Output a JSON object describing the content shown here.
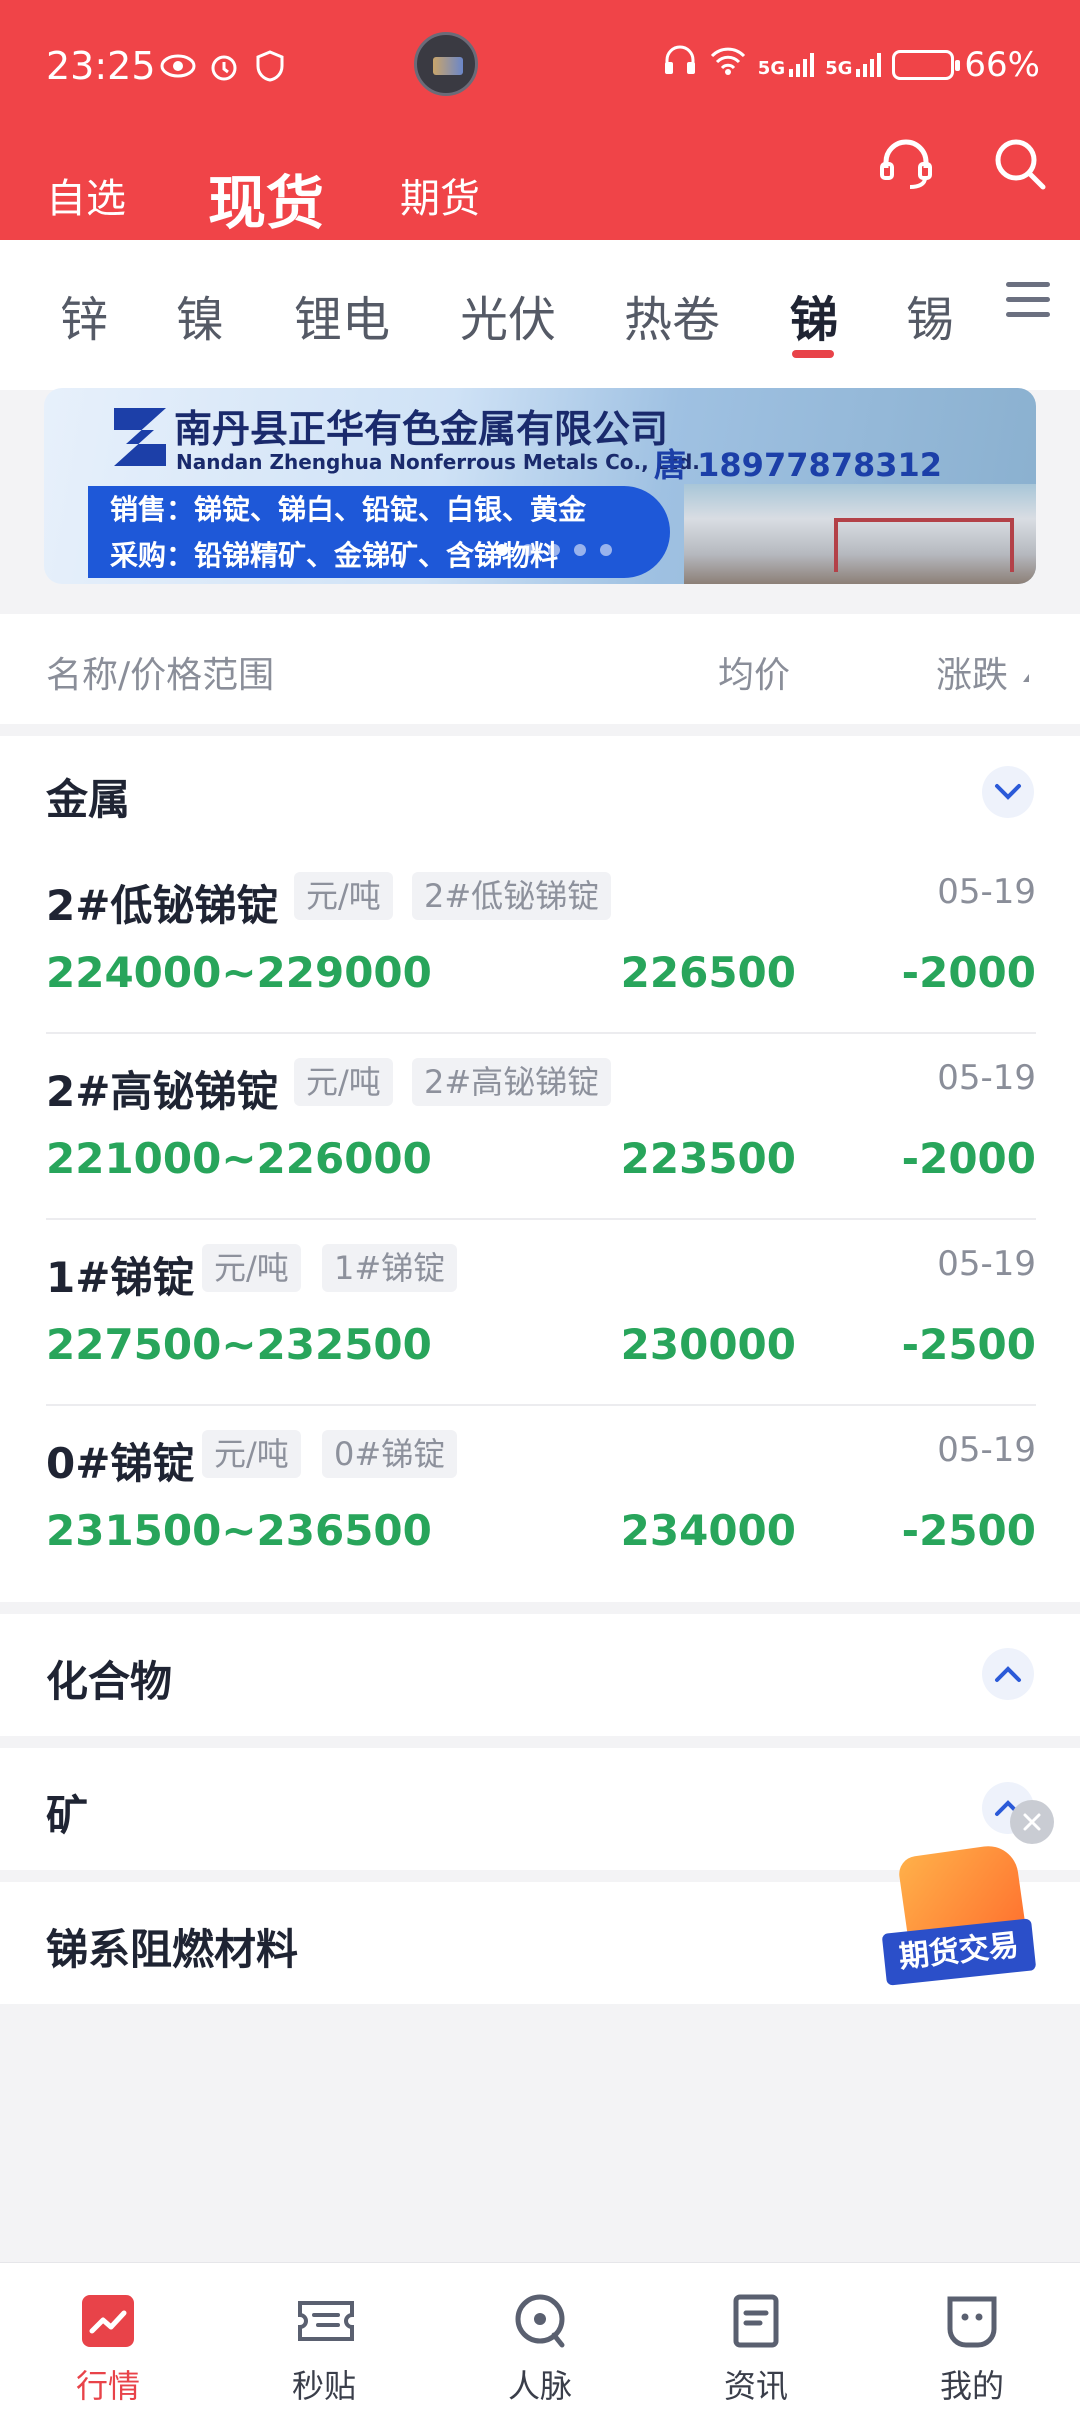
{
  "status_bar": {
    "time": "23:25",
    "battery": "66%",
    "net1": "5G",
    "net2": "5G"
  },
  "top_nav": {
    "tabs": [
      "自选",
      "现货",
      "期货"
    ],
    "active": "现货"
  },
  "categories": {
    "tabs": [
      "锌",
      "镍",
      "锂电",
      "光伏",
      "热卷",
      "锑",
      "锡"
    ],
    "active": "锑"
  },
  "banner": {
    "company_cn": "南丹县正华有色金属有限公司",
    "company_en": "Nandan Zhenghua Nonferrous Metals Co., Ltd.",
    "phone": "唐 18977878312",
    "sell_line": "销售：锑锭、锑白、铅锭、白银、黄金",
    "buy_line": "采购：铅锑精矿、金锑矿、含锑物料"
  },
  "list_header": {
    "name": "名称/价格范围",
    "avg": "均价",
    "change": "涨跌"
  },
  "sections": {
    "metal": {
      "title": "金属",
      "rows": [
        {
          "name": "2#低铋锑锭",
          "unit": "元/吨",
          "tag": "2#低铋锑锭",
          "date": "05-19",
          "range": "224000~229000",
          "avg": "226500",
          "change": "-2000"
        },
        {
          "name": "2#高铋锑锭",
          "unit": "元/吨",
          "tag": "2#高铋锑锭",
          "date": "05-19",
          "range": "221000~226000",
          "avg": "223500",
          "change": "-2000"
        },
        {
          "name": "1#锑锭",
          "unit": "元/吨",
          "tag": "1#锑锭",
          "date": "05-19",
          "range": "227500~232500",
          "avg": "230000",
          "change": "-2500"
        },
        {
          "name": "0#锑锭",
          "unit": "元/吨",
          "tag": "0#锑锭",
          "date": "05-19",
          "range": "231500~236500",
          "avg": "234000",
          "change": "-2500"
        }
      ]
    },
    "compound": {
      "title": "化合物"
    },
    "ore": {
      "title": "矿"
    },
    "flame": {
      "title": "锑系阻燃材料"
    }
  },
  "float_badge": {
    "label": "期货交易"
  },
  "bottom_nav": {
    "items": [
      "行情",
      "秒贴",
      "人脉",
      "资讯",
      "我的"
    ],
    "active": "行情"
  },
  "colors": {
    "brand_red": "#f04448",
    "price_green": "#28a55b",
    "accent_blue": "#2b4fc9"
  }
}
